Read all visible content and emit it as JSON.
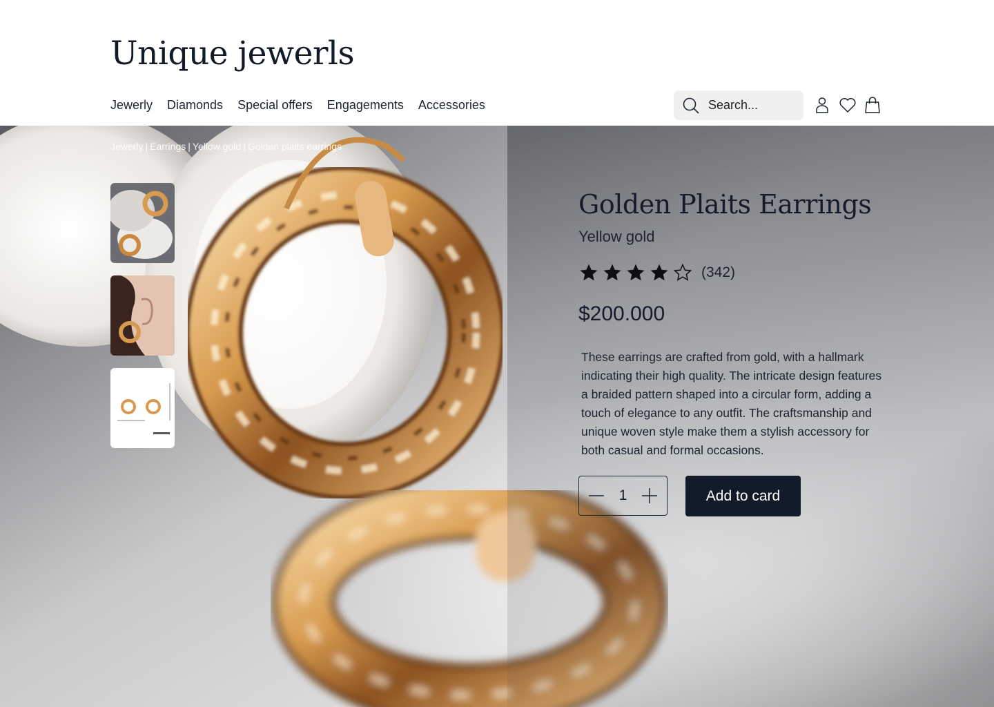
{
  "brand": {
    "name": "Unique jewerls"
  },
  "nav": {
    "items": [
      {
        "label": "Jewerly"
      },
      {
        "label": "Diamonds"
      },
      {
        "label": "Special offers"
      },
      {
        "label": "Engagements"
      },
      {
        "label": "Accessories"
      }
    ]
  },
  "search": {
    "placeholder": "Search...",
    "icon": "search-icon"
  },
  "header_icons": [
    "user-icon",
    "heart-icon",
    "shopping-bag-icon"
  ],
  "breadcrumb": {
    "items": [
      "Jewerly",
      "Earrings",
      "Yellow gold",
      "Golden plaits earrings"
    ],
    "separator": "|"
  },
  "product": {
    "title": "Golden Plaits Earrings",
    "variant": "Yellow gold",
    "rating": {
      "stars": 4,
      "max": 5,
      "count_label": "(342)"
    },
    "price": "$200.000",
    "description": "These earrings are crafted from gold, with a hallmark indicating their high quality. The intricate design features a braided pattern shaped into a circular form, adding a touch of elegance to any outfit. The craftsmanship and unique woven style make them a stylish accessory for both casual and formal occasions.",
    "quantity": "1",
    "add_button_label": "Add to card"
  },
  "thumbnails": [
    {
      "name": "thumbnail-earrings-on-stone"
    },
    {
      "name": "thumbnail-earring-worn"
    },
    {
      "name": "thumbnail-earrings-dimensions"
    }
  ],
  "colors": {
    "primary": "#111b29",
    "gold": "#d79a4e",
    "search_bg": "#f0f0f0"
  }
}
